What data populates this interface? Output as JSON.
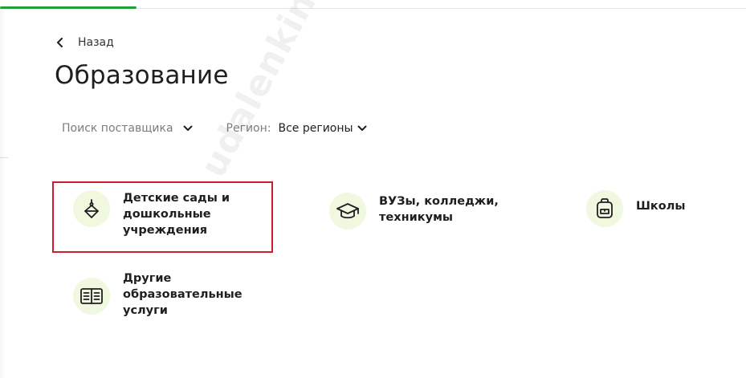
{
  "nav": {
    "back_label": "Назад"
  },
  "page": {
    "title": "Образование"
  },
  "filters": {
    "search_placeholder": "Поиск поставщика",
    "region_label": "Регион:",
    "region_value": "Все регионы"
  },
  "categories": [
    {
      "label": "Детские сады и дошкольные учреждения",
      "icon": "toy-top-icon",
      "highlighted": true
    },
    {
      "label": "ВУЗы, колледжи, техникумы",
      "icon": "graduation-cap-icon"
    },
    {
      "label": "Школы",
      "icon": "backpack-icon"
    },
    {
      "label": "Другие образовательные услуги",
      "icon": "open-book-icon"
    }
  ],
  "watermark": "udalenking.ru",
  "colors": {
    "accent_green": "#21a038",
    "icon_bg": "#f0f8e0",
    "highlight_red": "#cc1f2b"
  }
}
